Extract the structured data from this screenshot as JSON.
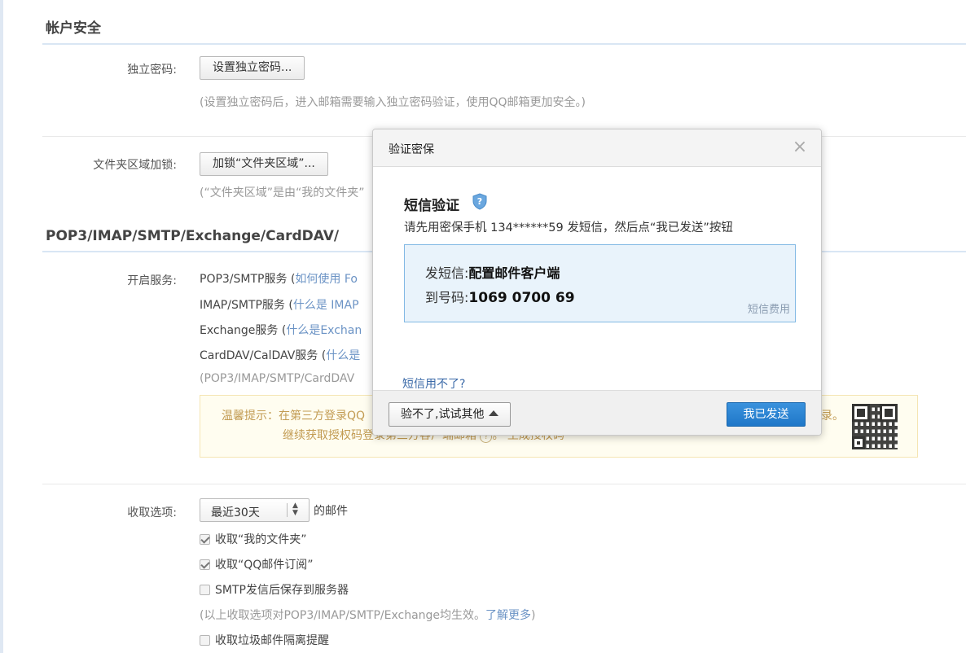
{
  "account_security": {
    "title": "帐户安全",
    "independent_password": {
      "label": "独立密码:",
      "button": "设置独立密码...",
      "hint": "(设置独立密码后，进入邮箱需要输入独立密码验证，使用QQ邮箱更加安全。)"
    },
    "folder_lock": {
      "label": "文件夹区域加锁:",
      "button": "加锁“文件夹区域”...",
      "hint": "(“文件夹区域”是由“我的文件夹”"
    }
  },
  "protocols": {
    "title": "POP3/IMAP/SMTP/Exchange/CardDAV/",
    "label": "开启服务:",
    "services": [
      {
        "name": "POP3/SMTP服务 (",
        "link": "如何使用 Fo"
      },
      {
        "name": "IMAP/SMTP服务 (",
        "link": "什么是 IMAP"
      },
      {
        "name": "Exchange服务 (",
        "link": "什么是Exchan"
      },
      {
        "name": "CardDAV/CalDAV服务 (",
        "link": "什么是"
      }
    ],
    "hint": "(POP3/IMAP/SMTP/CardDAV",
    "notice": {
      "line1": "温馨提示：在第三方登录QQ",
      "line1_tail": "录。",
      "line2": "继续获取授权码登录第三方客户端邮箱",
      "line2_tail": "。  生成授权码",
      "help_icon": "?"
    }
  },
  "receive_options": {
    "label": "收取选项:",
    "select_value": "最近30天",
    "select_suffix": "的邮件",
    "options": [
      {
        "label": "收取“我的文件夹”",
        "checked": true
      },
      {
        "label": "收取“QQ邮件订阅”",
        "checked": true
      },
      {
        "label": "SMTP发信后保存到服务器",
        "checked": false
      }
    ],
    "hint": "(以上收取选项对POP3/IMAP/SMTP/Exchange均生效。",
    "learn_more": "了解更多",
    "hint_end": ")",
    "junk_option": {
      "label": "收取垃圾邮件隔离提醒",
      "checked": false
    }
  },
  "modal": {
    "title": "验证密保",
    "close": "×",
    "sms_title": "短信验证",
    "desc": "请先用密保手机 134******59 发短信，然后点“我已发送”按钮",
    "send_label": "发短信:",
    "send_content": "配置邮件客户端",
    "to_label": "到号码:",
    "to_number": "1069 0700 69",
    "fee": "短信费用",
    "sms_unavailable": "短信用不了?",
    "alt_button": "验不了,试试其他",
    "sent_button": "我已发送"
  },
  "colors": {
    "accent": "#1f77c8",
    "link": "#6b93c5",
    "notice_text": "#c29b52",
    "sms_box_bg": "#e9f3fb"
  }
}
